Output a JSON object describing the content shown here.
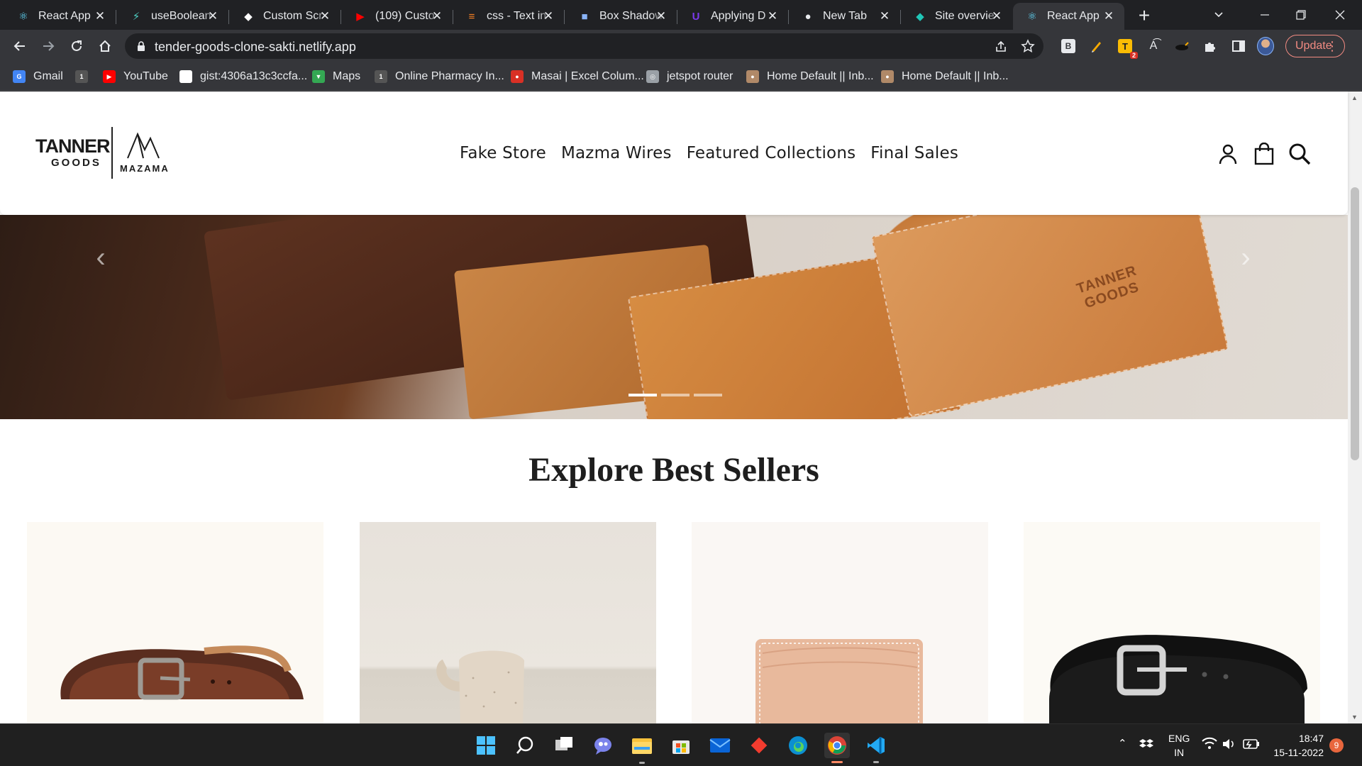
{
  "browser": {
    "tabs": [
      {
        "title": "React App",
        "favicon": "react-icon",
        "color": "#61dafb"
      },
      {
        "title": "useBoolean",
        "favicon": "lightning-icon",
        "color": "#4fd1c5"
      },
      {
        "title": "Custom Scr",
        "favicon": "codesandbox-icon",
        "color": "#ffffff"
      },
      {
        "title": "(109) Custo",
        "favicon": "youtube-icon",
        "color": "#ff0000"
      },
      {
        "title": "css - Text in",
        "favicon": "stackoverflow-icon",
        "color": "#f48024"
      },
      {
        "title": "Box Shadow",
        "favicon": "window-icon",
        "color": "#8ab4f8"
      },
      {
        "title": "Applying D",
        "favicon": "u-icon",
        "color": "#7c3aed"
      },
      {
        "title": "New Tab",
        "favicon": "chrome-icon",
        "color": "#e8eaed"
      },
      {
        "title": "Site overvie",
        "favicon": "netlify-icon",
        "color": "#20c6b7"
      },
      {
        "title": "React App",
        "favicon": "react-icon",
        "color": "#61dafb",
        "active": true
      }
    ],
    "url": "tender-goods-clone-sakti.netlify.app",
    "update_label": "Update",
    "extension_badge": "2",
    "bookmarks": [
      {
        "label": "Gmail",
        "icon": "google-icon",
        "color": "#4285f4"
      },
      {
        "label": "",
        "icon": "1mg-icon",
        "color": "#555555"
      },
      {
        "label": "YouTube",
        "icon": "youtube-icon",
        "color": "#ff0000"
      },
      {
        "label": "gist:4306a13c3ccfa...",
        "icon": "github-icon",
        "color": "#ffffff"
      },
      {
        "label": "Maps",
        "icon": "maps-icon",
        "color": "#34a853"
      },
      {
        "label": "Online Pharmacy In...",
        "icon": "1mg-icon",
        "color": "#555555"
      },
      {
        "label": "Masai | Excel Colum...",
        "icon": "masai-icon",
        "color": "#d93025"
      },
      {
        "label": "jetspot router",
        "icon": "globe-icon",
        "color": "#9aa0a6"
      },
      {
        "label": "Home Default || Inb...",
        "icon": "person-icon",
        "color": "#b08968"
      },
      {
        "label": "Home Default || Inb...",
        "icon": "person-icon",
        "color": "#b08968"
      }
    ]
  },
  "site": {
    "logo": {
      "brand_top": "TANNER",
      "brand_bottom": "GOODS",
      "partner": "MAZAMA"
    },
    "nav": [
      "Fake Store",
      "Mazma Wires",
      "Featured Collections",
      "Final Sales"
    ],
    "hero": {
      "watermark": "TANNER\nGOODS",
      "slide_count": 3,
      "active_slide": 1
    },
    "section_title": "Explore Best Sellers",
    "products": [
      {
        "name": "brown-leather-belt"
      },
      {
        "name": "ceramic-mug"
      },
      {
        "name": "natural-card-wallet"
      },
      {
        "name": "black-leather-belt"
      }
    ]
  },
  "taskbar": {
    "language": "ENG",
    "region": "IN",
    "time": "18:47",
    "date": "15-11-2022",
    "notification_count": "9"
  }
}
